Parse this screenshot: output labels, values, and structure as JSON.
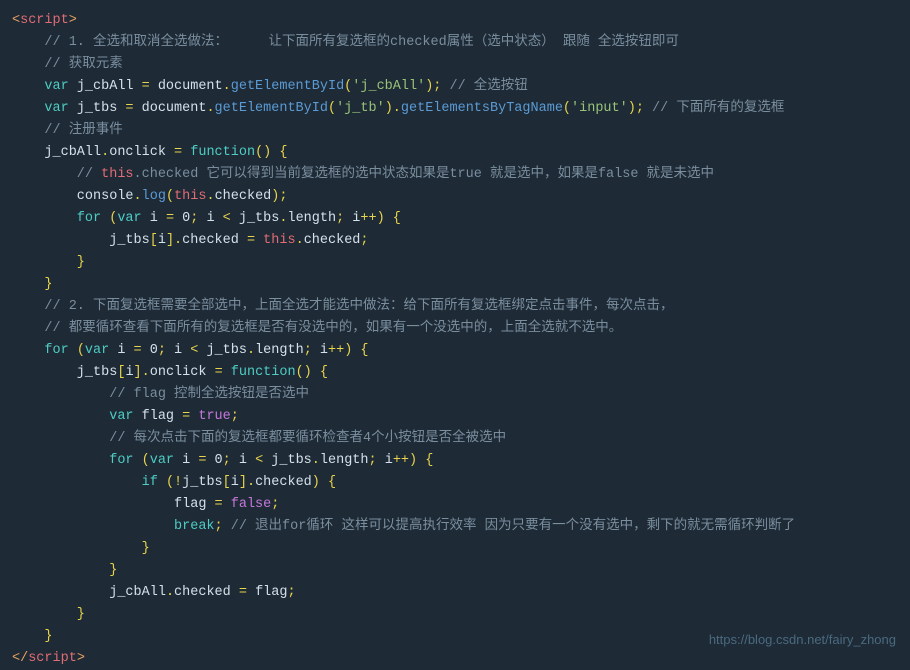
{
  "watermark": "https://blog.csdn.net/fairy_zhong",
  "lines": [
    {
      "id": 1,
      "indent": 0,
      "content": "script_open"
    },
    {
      "id": 2,
      "indent": 0,
      "content": "comment_1_header"
    },
    {
      "id": 3,
      "indent": 0,
      "content": "comment_get_elements"
    },
    {
      "id": 4,
      "indent": 0,
      "content": "var_j_cbAll"
    },
    {
      "id": 5,
      "indent": 0,
      "content": "var_j_tbs"
    },
    {
      "id": 6,
      "indent": 0,
      "content": "comment_register_event"
    },
    {
      "id": 7,
      "indent": 0,
      "content": "j_cbAll_onclick"
    },
    {
      "id": 8,
      "indent": 1,
      "content": "comment_this_checked"
    },
    {
      "id": 9,
      "indent": 1,
      "content": "console_log"
    },
    {
      "id": 10,
      "indent": 1,
      "content": "for_loop_1"
    },
    {
      "id": 11,
      "indent": 2,
      "content": "j_tbs_checked_this"
    },
    {
      "id": 12,
      "indent": 1,
      "content": "close_brace"
    },
    {
      "id": 13,
      "indent": 0,
      "content": "close_brace_main"
    },
    {
      "id": 14,
      "indent": 0,
      "content": "comment_2_header_1"
    },
    {
      "id": 15,
      "indent": 0,
      "content": "comment_2_header_2"
    },
    {
      "id": 16,
      "indent": 0,
      "content": "for_j_tbs"
    },
    {
      "id": 17,
      "indent": 1,
      "content": "j_tbs_onclick_function"
    },
    {
      "id": 18,
      "indent": 2,
      "content": "comment_flag_control"
    },
    {
      "id": 19,
      "indent": 2,
      "content": "var_flag_true"
    },
    {
      "id": 20,
      "indent": 2,
      "content": "comment_each_click"
    },
    {
      "id": 21,
      "indent": 2,
      "content": "for_inner"
    },
    {
      "id": 22,
      "indent": 3,
      "content": "if_not_checked"
    },
    {
      "id": 23,
      "indent": 4,
      "content": "flag_false"
    },
    {
      "id": 24,
      "indent": 4,
      "content": "break_comment"
    },
    {
      "id": 25,
      "indent": 3,
      "content": "close_brace_if"
    },
    {
      "id": 26,
      "indent": 2,
      "content": "close_brace_for"
    },
    {
      "id": 27,
      "indent": 2,
      "content": "j_cbAll_checked_flag"
    },
    {
      "id": 28,
      "indent": 1,
      "content": "close_brace_fn"
    },
    {
      "id": 29,
      "indent": 0,
      "content": "close_brace_outer"
    },
    {
      "id": 30,
      "indent": 0,
      "content": "script_close"
    }
  ]
}
